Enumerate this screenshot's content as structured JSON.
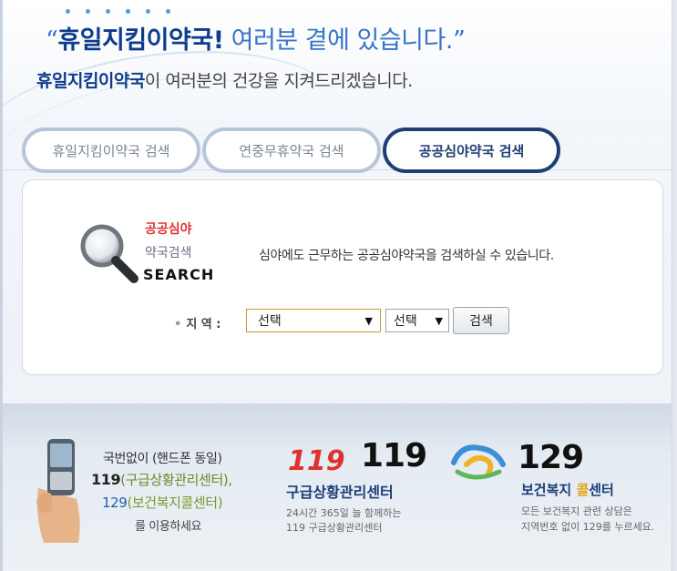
{
  "header": {
    "open_quote": "“",
    "brand": "휴일지킴이약국",
    "bang": "!",
    "tagline_rest": "여러분 곁에 있습니다.",
    "close_quote": "”",
    "subline_brand": "휴일지킴이약국",
    "subline_rest": "이 여러분의 건강을 지켜드리겠습니다."
  },
  "tabs": [
    {
      "label": "휴일지킴이약국 검색",
      "active": false
    },
    {
      "label": "연중무휴약국 검색",
      "active": false
    },
    {
      "label": "공공심야약국 검색",
      "active": true
    }
  ],
  "search": {
    "logo_line1": "공공심야",
    "logo_line2": "약국검색",
    "logo_line3": "SEARCH",
    "description": "심야에도 근무하는 공공심야약국을 검색하실 수 있습니다.",
    "region_label": "지 역 :",
    "region_select_value": "선택",
    "subregion_select_value": "선택",
    "button_label": "검색"
  },
  "banner": {
    "line1": "국번없이 (핸드폰 동일)",
    "line2_num": "119",
    "line2_sub": "(구급상황관리센터),",
    "line3_num": "129",
    "line3_sub": "(보건복지콜센터)",
    "line4": "를 이용하세요",
    "e119": {
      "logo_text": "119",
      "number": "119",
      "title": "구급상황관리센터",
      "desc1": "24시간 365일 늘 함께하는",
      "desc2": "119 구급상황관리센터"
    },
    "e129": {
      "number": "129",
      "title_a": "보건복지 ",
      "title_hl": "콜",
      "title_b": "센터",
      "desc1": "모든 보건복지 관련 상담은",
      "desc2": "지역번호 없이 129를 누르세요."
    }
  },
  "colors": {
    "brand_navy": "#1f3f73",
    "accent_blue": "#2f6ad1",
    "emergency_red": "#e0312f"
  }
}
